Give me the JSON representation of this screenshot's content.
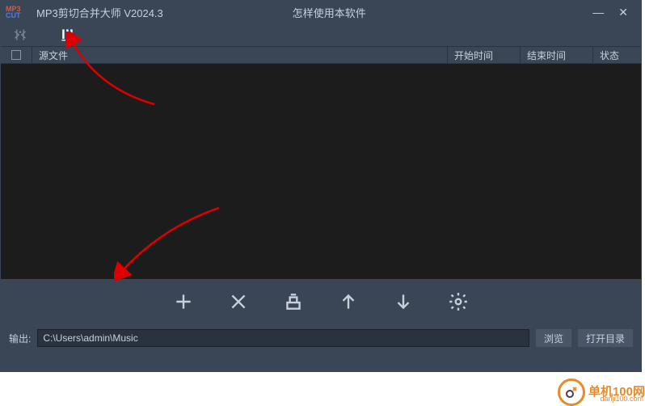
{
  "titlebar": {
    "logo1": "MP3",
    "logo2": "CUT",
    "title": "MP3剪切合并大师 V2024.3",
    "help": "怎样使用本软件"
  },
  "columns": {
    "source": "源文件",
    "start": "开始时间",
    "end": "结束时间",
    "status": "状态"
  },
  "output": {
    "label": "输出:",
    "path": "C:\\Users\\admin\\Music",
    "browse": "浏览",
    "open": "打开目录"
  },
  "watermark": {
    "text": "单机100网",
    "sub": "danji100.com"
  }
}
